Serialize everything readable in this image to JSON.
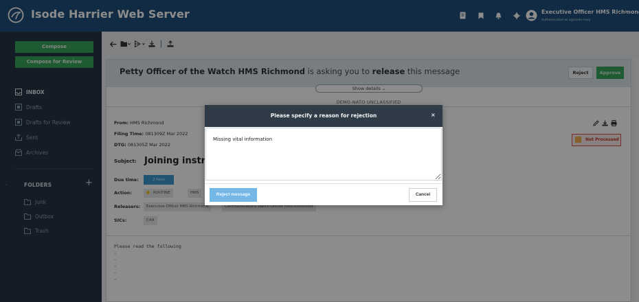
{
  "header": {
    "title": "Isode Harrier Web Server",
    "user_name": "Executive Officer HMS Richmond",
    "user_sub": "Authenticated as o@isode.navy",
    "bg_color": "#1e4f7a"
  },
  "sidebar": {
    "compose_label": "Compose",
    "compose_review_label": "Compose for Review",
    "items": [
      {
        "label": "INBOX",
        "icon": "inbox-icon"
      },
      {
        "label": "Drafts",
        "icon": "drafts-icon"
      },
      {
        "label": "Drafts for Review",
        "icon": "drafts-review-icon"
      },
      {
        "label": "Sent",
        "icon": "sent-icon"
      },
      {
        "label": "Archives",
        "icon": "archive-icon"
      }
    ],
    "folders_label": "FOLDERS",
    "folders_add": "+",
    "folders": [
      {
        "label": "Junk",
        "icon": "folder-icon"
      },
      {
        "label": "Outbox",
        "icon": "folder-icon"
      },
      {
        "label": "Trash",
        "icon": "folder-icon"
      }
    ]
  },
  "message": {
    "release_requester": "Petty Officer of the Watch HMS Richmond",
    "release_middle": " is asking you to ",
    "release_action": "release",
    "release_end": " this message",
    "reject_label": "Reject",
    "approve_label": "Approve",
    "show_details": "Show details ⌄",
    "classification": "DEMO-NATO UNCLASSIFIED",
    "from_label": "From:",
    "from_value": "HMS Richmond",
    "filing_label": "Filing Time:",
    "filing_value": "081309Z Mar 2022",
    "dtg_label": "DTG:",
    "dtg_value": "081305Z Mar 2022",
    "subject_label": "Subject:",
    "subject_value": "Joining instruct",
    "due_label": "Due time:",
    "due_value": "2 hour",
    "action_label": "Action:",
    "action_priority": "ROUTINE",
    "action_recipient": "HMS",
    "releasers_label": "Releasers:",
    "releaser_1": "Executive Officer HMS Richmond",
    "releaser_2": "Communications Watch Officer HMS Richmond",
    "sics_label": "SICs:",
    "sic_1": "CAA",
    "status": "Not Processed",
    "body": "Please read the following\n-\n-\n-\n-\n-",
    "nav_arrows": "‹ ›"
  },
  "modal": {
    "title": "Please specify a reason for rejection",
    "close": "×",
    "reason_value": "Missing vital information",
    "reject_button": "Reject message",
    "cancel_button": "Cancel"
  }
}
